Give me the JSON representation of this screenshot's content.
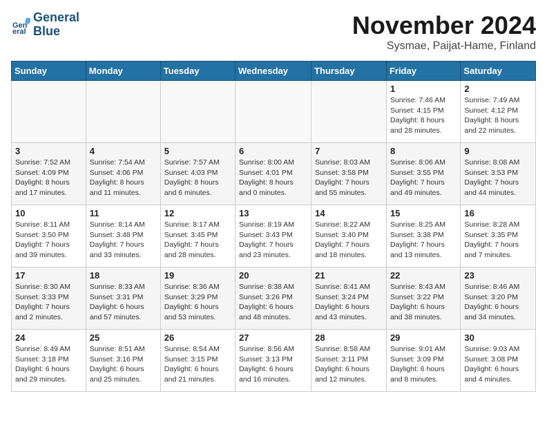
{
  "logo": {
    "line1": "General",
    "line2": "Blue"
  },
  "title": "November 2024",
  "subtitle": "Sysmae, Paijat-Hame, Finland",
  "days_of_week": [
    "Sunday",
    "Monday",
    "Tuesday",
    "Wednesday",
    "Thursday",
    "Friday",
    "Saturday"
  ],
  "weeks": [
    [
      {
        "day": "",
        "info": ""
      },
      {
        "day": "",
        "info": ""
      },
      {
        "day": "",
        "info": ""
      },
      {
        "day": "",
        "info": ""
      },
      {
        "day": "",
        "info": ""
      },
      {
        "day": "1",
        "info": "Sunrise: 7:46 AM\nSunset: 4:15 PM\nDaylight: 8 hours\nand 28 minutes."
      },
      {
        "day": "2",
        "info": "Sunrise: 7:49 AM\nSunset: 4:12 PM\nDaylight: 8 hours\nand 22 minutes."
      }
    ],
    [
      {
        "day": "3",
        "info": "Sunrise: 7:52 AM\nSunset: 4:09 PM\nDaylight: 8 hours\nand 17 minutes."
      },
      {
        "day": "4",
        "info": "Sunrise: 7:54 AM\nSunset: 4:06 PM\nDaylight: 8 hours\nand 11 minutes."
      },
      {
        "day": "5",
        "info": "Sunrise: 7:57 AM\nSunset: 4:03 PM\nDaylight: 8 hours\nand 6 minutes."
      },
      {
        "day": "6",
        "info": "Sunrise: 8:00 AM\nSunset: 4:01 PM\nDaylight: 8 hours\nand 0 minutes."
      },
      {
        "day": "7",
        "info": "Sunrise: 8:03 AM\nSunset: 3:58 PM\nDaylight: 7 hours\nand 55 minutes."
      },
      {
        "day": "8",
        "info": "Sunrise: 8:06 AM\nSunset: 3:55 PM\nDaylight: 7 hours\nand 49 minutes."
      },
      {
        "day": "9",
        "info": "Sunrise: 8:08 AM\nSunset: 3:53 PM\nDaylight: 7 hours\nand 44 minutes."
      }
    ],
    [
      {
        "day": "10",
        "info": "Sunrise: 8:11 AM\nSunset: 3:50 PM\nDaylight: 7 hours\nand 39 minutes."
      },
      {
        "day": "11",
        "info": "Sunrise: 8:14 AM\nSunset: 3:48 PM\nDaylight: 7 hours\nand 33 minutes."
      },
      {
        "day": "12",
        "info": "Sunrise: 8:17 AM\nSunset: 3:45 PM\nDaylight: 7 hours\nand 28 minutes."
      },
      {
        "day": "13",
        "info": "Sunrise: 8:19 AM\nSunset: 3:43 PM\nDaylight: 7 hours\nand 23 minutes."
      },
      {
        "day": "14",
        "info": "Sunrise: 8:22 AM\nSunset: 3:40 PM\nDaylight: 7 hours\nand 18 minutes."
      },
      {
        "day": "15",
        "info": "Sunrise: 8:25 AM\nSunset: 3:38 PM\nDaylight: 7 hours\nand 13 minutes."
      },
      {
        "day": "16",
        "info": "Sunrise: 8:28 AM\nSunset: 3:35 PM\nDaylight: 7 hours\nand 7 minutes."
      }
    ],
    [
      {
        "day": "17",
        "info": "Sunrise: 8:30 AM\nSunset: 3:33 PM\nDaylight: 7 hours\nand 2 minutes."
      },
      {
        "day": "18",
        "info": "Sunrise: 8:33 AM\nSunset: 3:31 PM\nDaylight: 6 hours\nand 57 minutes."
      },
      {
        "day": "19",
        "info": "Sunrise: 8:36 AM\nSunset: 3:29 PM\nDaylight: 6 hours\nand 53 minutes."
      },
      {
        "day": "20",
        "info": "Sunrise: 8:38 AM\nSunset: 3:26 PM\nDaylight: 6 hours\nand 48 minutes."
      },
      {
        "day": "21",
        "info": "Sunrise: 8:41 AM\nSunset: 3:24 PM\nDaylight: 6 hours\nand 43 minutes."
      },
      {
        "day": "22",
        "info": "Sunrise: 8:43 AM\nSunset: 3:22 PM\nDaylight: 6 hours\nand 38 minutes."
      },
      {
        "day": "23",
        "info": "Sunrise: 8:46 AM\nSunset: 3:20 PM\nDaylight: 6 hours\nand 34 minutes."
      }
    ],
    [
      {
        "day": "24",
        "info": "Sunrise: 8:49 AM\nSunset: 3:18 PM\nDaylight: 6 hours\nand 29 minutes."
      },
      {
        "day": "25",
        "info": "Sunrise: 8:51 AM\nSunset: 3:16 PM\nDaylight: 6 hours\nand 25 minutes."
      },
      {
        "day": "26",
        "info": "Sunrise: 8:54 AM\nSunset: 3:15 PM\nDaylight: 6 hours\nand 21 minutes."
      },
      {
        "day": "27",
        "info": "Sunrise: 8:56 AM\nSunset: 3:13 PM\nDaylight: 6 hours\nand 16 minutes."
      },
      {
        "day": "28",
        "info": "Sunrise: 8:58 AM\nSunset: 3:11 PM\nDaylight: 6 hours\nand 12 minutes."
      },
      {
        "day": "29",
        "info": "Sunrise: 9:01 AM\nSunset: 3:09 PM\nDaylight: 6 hours\nand 8 minutes."
      },
      {
        "day": "30",
        "info": "Sunrise: 9:03 AM\nSunset: 3:08 PM\nDaylight: 6 hours\nand 4 minutes."
      }
    ]
  ]
}
